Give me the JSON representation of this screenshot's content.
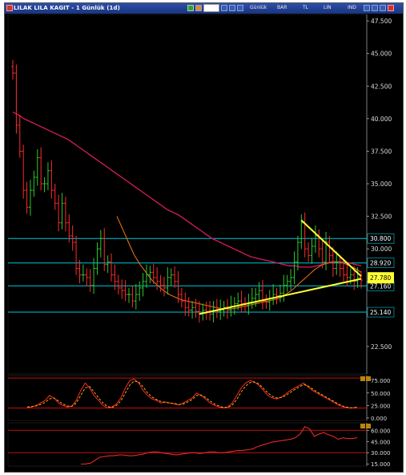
{
  "window": {
    "title": "LILAK LILA KAGIT - 1 Günlük (1d)",
    "toolbar": {
      "period": "Günlük",
      "bar_label": "BAR",
      "tl_label": "TL",
      "lin_label": "LIN",
      "ind_label": "IND"
    }
  },
  "colors": {
    "price_bar_up": "#2ec72e",
    "price_bar_down": "#ff2a2a",
    "ma_long": "#d81b5f",
    "ma_short": "#e0701a",
    "support_lines": "#00c8d8",
    "trendline": "#ffff33",
    "current_price_bg": "#ffff33"
  },
  "chart_data": [
    {
      "type": "candlestick",
      "title": "",
      "ylim": [
        20.4,
        48.0
      ],
      "y_ticks": [
        "47.500",
        "45.000",
        "42.500",
        "40.000",
        "37.500",
        "35.000",
        "32.500",
        "30.000",
        "27.500",
        "25.000",
        "22.500"
      ],
      "y_tick_values": [
        47.5,
        45.0,
        42.5,
        40.0,
        37.5,
        35.0,
        32.5,
        30.0,
        27.5,
        25.0,
        22.5
      ],
      "horizontal_levels": [
        {
          "label": "30.800",
          "value": 30.8
        },
        {
          "label": "28.920",
          "value": 28.92
        },
        {
          "label": "27.160",
          "value": 27.16
        },
        {
          "label": "25.140",
          "value": 25.14
        }
      ],
      "current_price": {
        "label": "27.780",
        "value": 27.78
      },
      "close_approx": [
        43.5,
        39.5,
        37.5,
        34.5,
        33.2,
        34.5,
        35.5,
        37.0,
        35.0,
        35.0,
        36.0,
        34.5,
        33.5,
        32.0,
        33.5,
        32.0,
        31.0,
        30.5,
        28.5,
        28.0,
        28.0,
        27.8,
        27.2,
        28.5,
        30.0,
        30.8,
        28.8,
        29.0,
        28.0,
        27.5,
        27.0,
        26.8,
        26.5,
        26.5,
        26.0,
        26.5,
        27.0,
        27.5,
        28.0,
        28.2,
        27.8,
        27.5,
        27.2,
        27.0,
        27.8,
        28.0,
        27.5,
        26.5,
        26.0,
        25.5,
        25.3,
        25.5,
        25.2,
        25.0,
        25.3,
        25.2,
        25.0,
        25.5,
        25.2,
        25.3,
        25.5,
        25.3,
        25.6,
        25.8,
        26.0,
        25.8,
        25.6,
        25.9,
        26.2,
        26.5,
        26.8,
        26.0,
        25.9,
        26.2,
        26.5,
        26.4,
        26.6,
        27.2,
        27.5,
        27.8,
        29.0,
        30.5,
        32.0,
        30.0,
        29.5,
        30.2,
        31.0,
        30.0,
        29.0,
        30.5,
        29.5,
        28.5,
        29.0,
        28.5,
        28.0,
        27.8,
        28.0,
        27.5,
        27.8,
        27.6
      ],
      "ma_long_approx": [
        40.5,
        40.3,
        40.0,
        39.8,
        39.6,
        39.4,
        39.2,
        39.0,
        38.8,
        38.6,
        38.4,
        38.1,
        37.8,
        37.5,
        37.2,
        36.9,
        36.6,
        36.3,
        36.0,
        35.7,
        35.4,
        35.1,
        34.8,
        34.5,
        34.2,
        33.9,
        33.6,
        33.3,
        33.0,
        32.8,
        32.6,
        32.3,
        32.0,
        31.7,
        31.4,
        31.1,
        30.8,
        30.6,
        30.4,
        30.2,
        30.0,
        29.8,
        29.6,
        29.4,
        29.3,
        29.2,
        29.1,
        29.0,
        28.9,
        28.8,
        28.7,
        28.7,
        28.6,
        28.6,
        28.6,
        28.7,
        28.8,
        28.9,
        29.0,
        29.0,
        29.0,
        28.9,
        28.8,
        28.7
      ],
      "ma_short_approx": [
        32.5,
        31.5,
        30.5,
        29.5,
        28.8,
        28.2,
        27.6,
        27.2,
        26.8,
        26.5,
        26.3,
        26.1,
        26.0,
        25.9,
        25.8,
        25.7,
        25.6,
        25.5,
        25.4,
        25.4,
        25.4,
        25.5,
        25.6,
        25.7,
        25.8,
        25.9,
        26.0,
        26.1,
        26.2,
        26.5,
        26.8,
        27.2,
        27.6,
        28.0,
        28.4,
        28.7,
        28.9,
        29.0,
        29.0,
        28.9,
        28.7,
        28.5,
        28.2
      ],
      "trendlines": [
        {
          "from": [
            53,
            25.0
          ],
          "to": [
            99,
            27.7
          ]
        },
        {
          "from": [
            82,
            32.2
          ],
          "to": [
            99,
            27.9
          ]
        }
      ]
    },
    {
      "type": "line",
      "title": "",
      "ylim": [
        -5,
        85
      ],
      "y_ticks": [
        "75.000",
        "50.000",
        "25.000",
        "0.000"
      ],
      "y_tick_values": [
        75,
        50,
        25,
        0
      ],
      "levels": [
        20,
        80
      ],
      "series": [
        {
          "color": "#ff2a2a",
          "style": "solid",
          "values": [
            20,
            22,
            25,
            30,
            35,
            45,
            40,
            30,
            25,
            22,
            24,
            35,
            55,
            70,
            60,
            45,
            35,
            25,
            20,
            22,
            28,
            40,
            60,
            75,
            78,
            70,
            55,
            45,
            38,
            35,
            30,
            32,
            30,
            28,
            26,
            30,
            35,
            40,
            50,
            45,
            38,
            30,
            25,
            22,
            20,
            22,
            30,
            45,
            60,
            70,
            75,
            72,
            65,
            55,
            45,
            40,
            38,
            42,
            48,
            55,
            60,
            65,
            70,
            62,
            55,
            50,
            45,
            40,
            35,
            30,
            25,
            22,
            20,
            20,
            22
          ]
        },
        {
          "color": "#ffaa00",
          "style": "dashed",
          "values": [
            22,
            23,
            24,
            27,
            31,
            38,
            40,
            34,
            28,
            24,
            23,
            30,
            45,
            60,
            63,
            52,
            40,
            30,
            23,
            21,
            25,
            34,
            50,
            66,
            74,
            72,
            62,
            50,
            42,
            37,
            33,
            31,
            30,
            29,
            27,
            28,
            32,
            37,
            45,
            46,
            41,
            34,
            28,
            24,
            21,
            21,
            26,
            37,
            52,
            64,
            71,
            72,
            68,
            59,
            50,
            43,
            40,
            41,
            45,
            51,
            57,
            62,
            67,
            64,
            58,
            52,
            47,
            42,
            37,
            32,
            27,
            23,
            21,
            20,
            21
          ]
        }
      ]
    },
    {
      "type": "line",
      "title": "",
      "ylim": [
        12,
        70
      ],
      "y_ticks": [
        "60.000",
        "45.000",
        "30.000",
        "15.000"
      ],
      "y_tick_values": [
        60,
        45,
        30,
        15
      ],
      "levels": [
        30,
        60
      ],
      "series": [
        {
          "color": "#ff2a2a",
          "style": "solid",
          "values": [
            15,
            15,
            16,
            20,
            24,
            25,
            26,
            26,
            27,
            27,
            26,
            26,
            27,
            28,
            30,
            31,
            31,
            30,
            29,
            28,
            27,
            28,
            29,
            30,
            30,
            29,
            30,
            31,
            31,
            30,
            30,
            31,
            32,
            33,
            33,
            34,
            35,
            38,
            40,
            42,
            44,
            45,
            46,
            47,
            48,
            50,
            55,
            65,
            62,
            52,
            55,
            57,
            54,
            52,
            48,
            50,
            49,
            49,
            50
          ]
        }
      ]
    }
  ]
}
